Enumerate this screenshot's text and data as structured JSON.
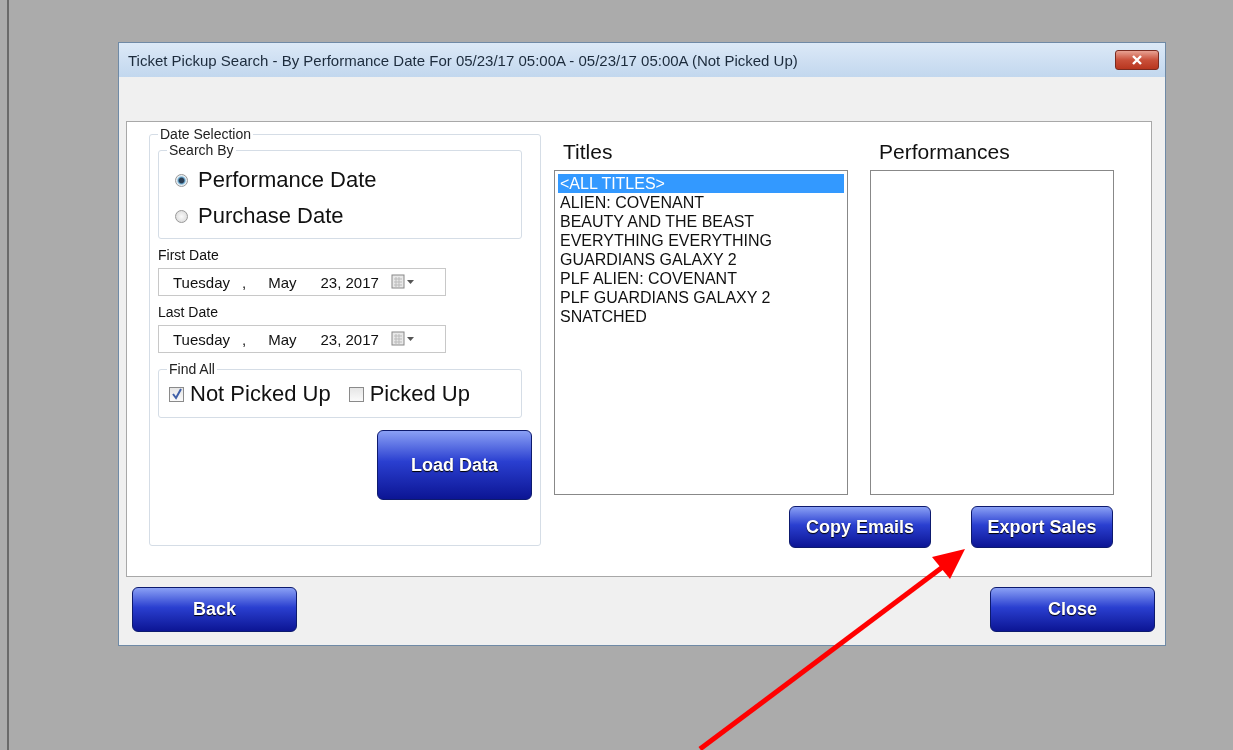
{
  "window": {
    "title": "Ticket Pickup Search - By Performance Date For 05/23/17 05:00A - 05/23/17 05:00A (Not Picked Up)"
  },
  "date_selection": {
    "label": "Date Selection",
    "search_by": {
      "label": "Search By",
      "options": [
        {
          "label": "Performance Date",
          "selected": true
        },
        {
          "label": "Purchase Date",
          "selected": false
        }
      ]
    },
    "date_fields": [
      {
        "label": "First Date",
        "parts": [
          "Tuesday",
          ",",
          "May",
          "23, 2017"
        ]
      },
      {
        "label": "Last Date",
        "parts": [
          "Tuesday",
          ",",
          "May",
          "23, 2017"
        ]
      }
    ],
    "find_all": {
      "label": "Find All",
      "options": [
        {
          "label": "Not Picked Up",
          "checked": true
        },
        {
          "label": "Picked Up",
          "checked": false
        }
      ]
    },
    "load_button": "Load Data"
  },
  "titles": {
    "label": "Titles",
    "items": [
      {
        "label": "<ALL TITLES>",
        "selected": true
      },
      {
        "label": "ALIEN: COVENANT",
        "selected": false
      },
      {
        "label": "BEAUTY AND THE BEAST",
        "selected": false
      },
      {
        "label": "EVERYTHING EVERYTHING",
        "selected": false
      },
      {
        "label": "GUARDIANS GALAXY 2",
        "selected": false
      },
      {
        "label": "PLF ALIEN: COVENANT",
        "selected": false
      },
      {
        "label": "PLF GUARDIANS GALAXY 2",
        "selected": false
      },
      {
        "label": "SNATCHED",
        "selected": false
      }
    ]
  },
  "performances": {
    "label": "Performances"
  },
  "action_buttons": [
    "Copy Emails",
    "Export Sales"
  ],
  "footer_buttons": [
    "Back",
    "Close"
  ]
}
